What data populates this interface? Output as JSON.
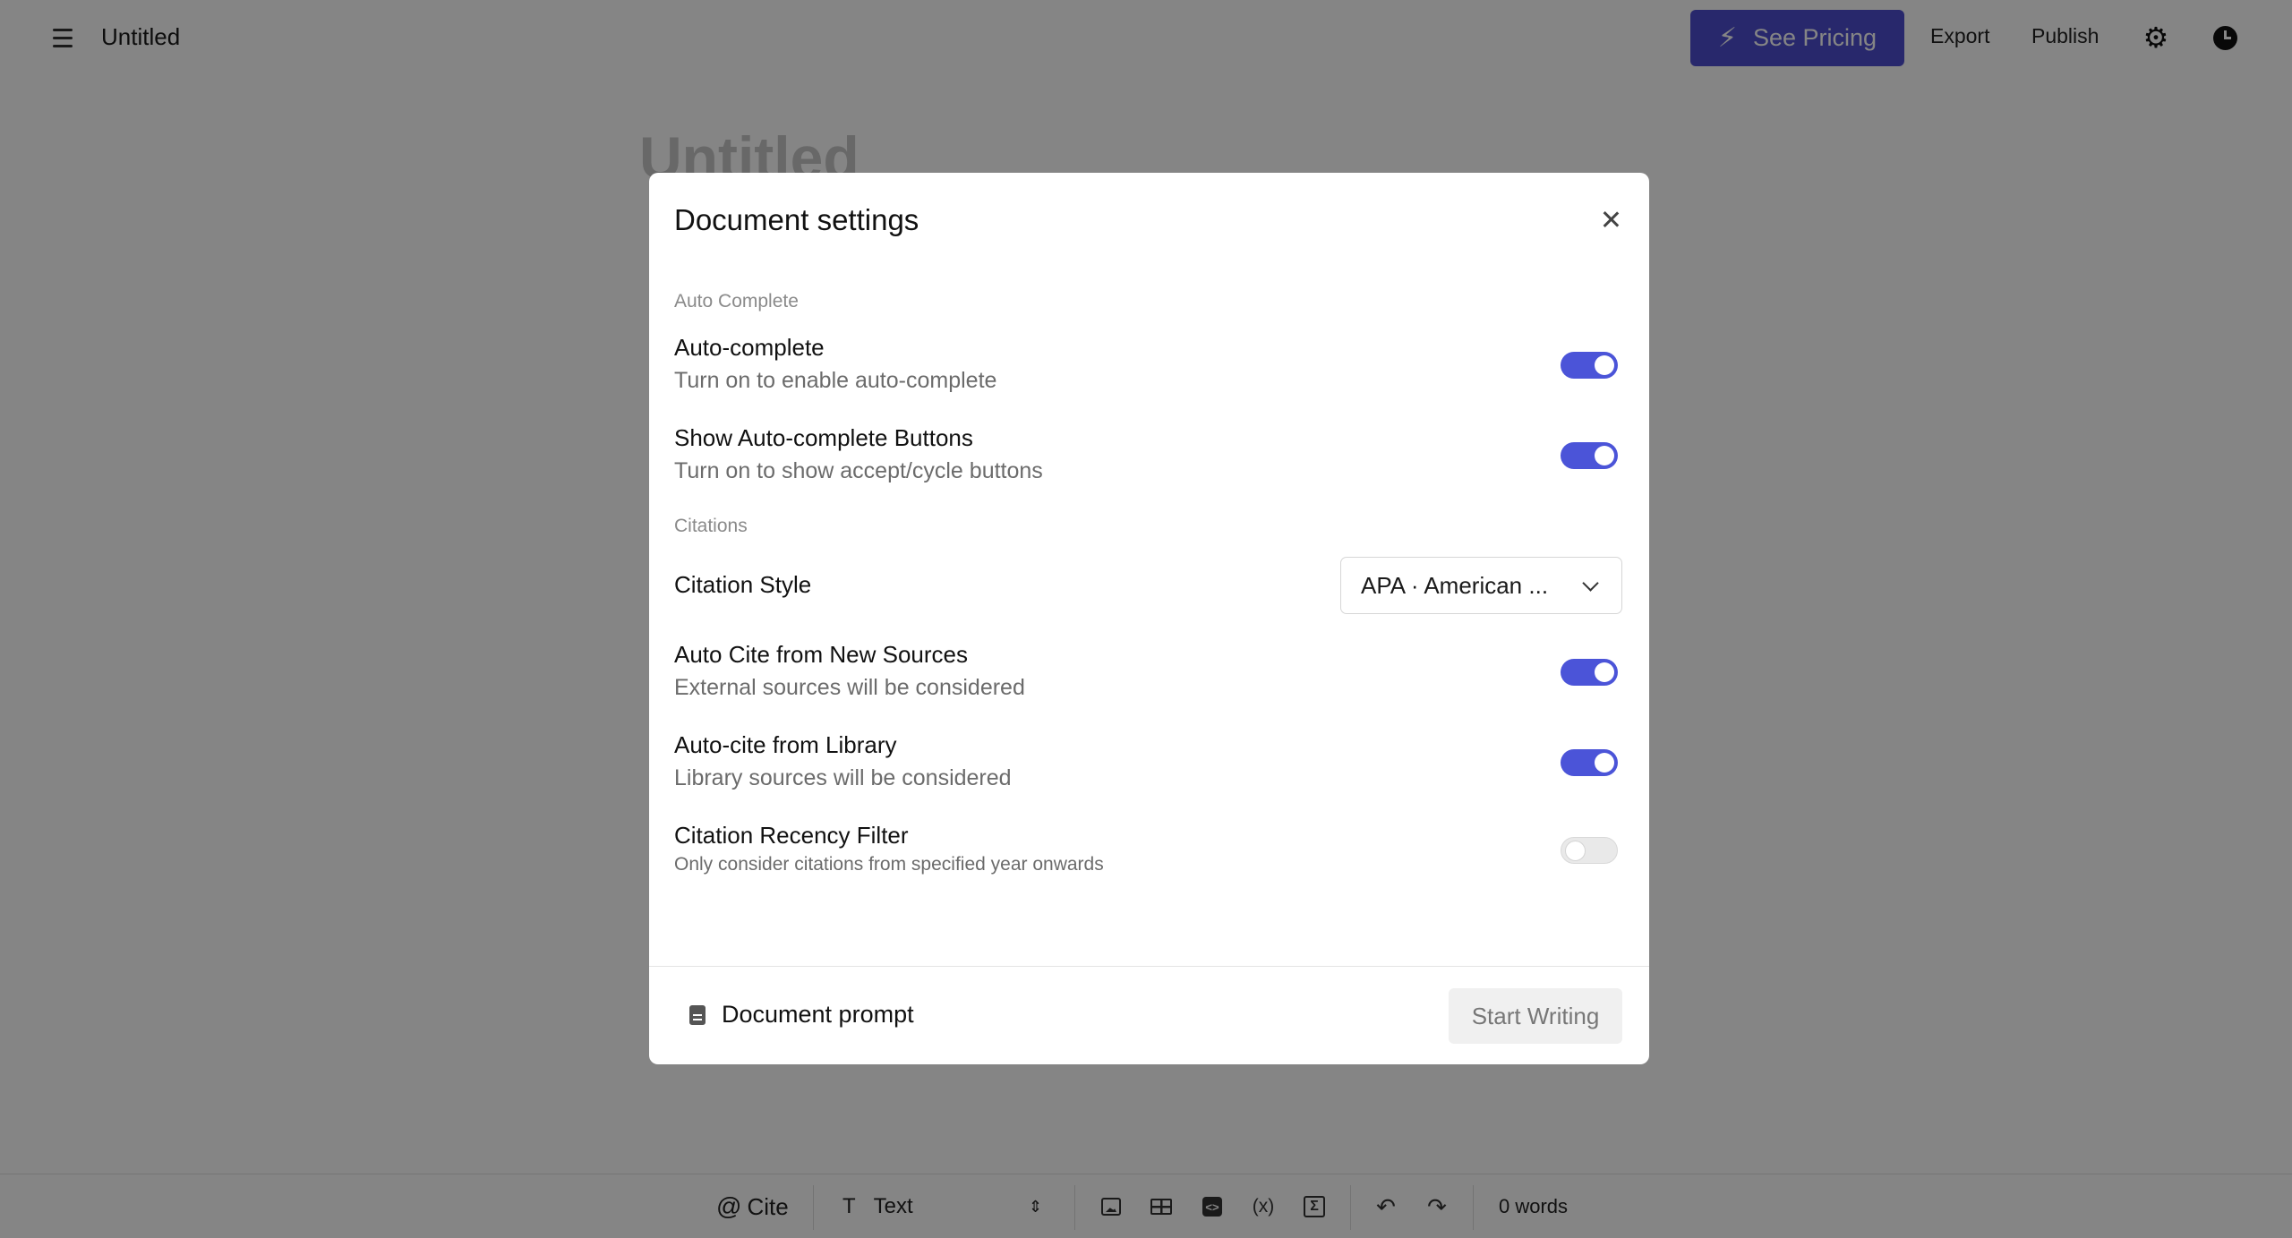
{
  "header": {
    "doc_name": "Untitled",
    "pricing_label": "See Pricing",
    "export_label": "Export",
    "publish_label": "Publish"
  },
  "editor": {
    "title": "Untitled"
  },
  "modal": {
    "title": "Document settings",
    "sections": {
      "auto_complete": "Auto Complete",
      "citations": "Citations"
    },
    "settings": {
      "auto_complete": {
        "title": "Auto-complete",
        "desc": "Turn on to enable auto-complete",
        "enabled": true
      },
      "show_buttons": {
        "title": "Show Auto-complete Buttons",
        "desc": "Turn on to show accept/cycle buttons",
        "enabled": true
      },
      "citation_style": {
        "title": "Citation Style",
        "value": "APA · American ..."
      },
      "auto_cite_new": {
        "title": "Auto Cite from New Sources",
        "desc": "External sources will be considered",
        "enabled": true
      },
      "auto_cite_library": {
        "title": "Auto-cite from Library",
        "desc": "Library sources will be considered",
        "enabled": true
      },
      "recency_filter": {
        "title": "Citation Recency Filter",
        "desc": "Only consider citations from specified year onwards",
        "enabled": false
      }
    },
    "footer": {
      "doc_prompt_label": "Document prompt",
      "start_label": "Start Writing"
    }
  },
  "toolbar": {
    "cite_label": "Cite",
    "text_style_label": "Text",
    "word_count": "0 words"
  },
  "colors": {
    "accent": "#4e4ecf",
    "toggle_on": "#4b54d8"
  }
}
